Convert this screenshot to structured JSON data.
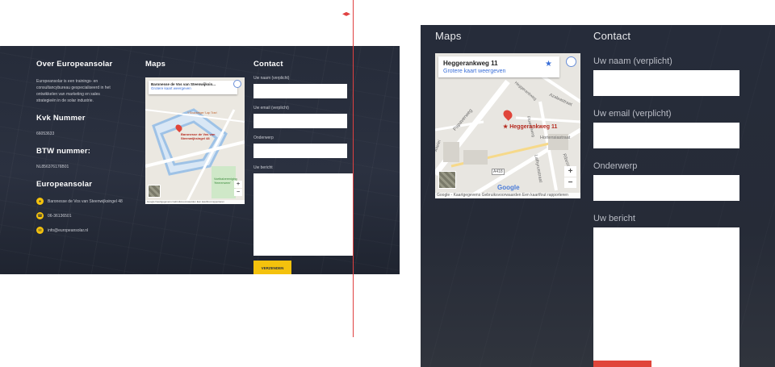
{
  "left": {
    "about": {
      "title": "Over Europeansolar",
      "text": "Europeansolar is een trainings- en consultancybureau gespecialiseerd in het ontwikkelen van marketing en sales strategieën in de solar industrie.",
      "kvk_title": "Kvk Nummer",
      "kvk_value": "66053633",
      "btw_title": "BTW nummer:",
      "btw_value": "NL856376176B01",
      "company_title": "Europeansolar",
      "contacts": [
        {
          "icon": "location-icon",
          "text": "Baronesse de Vos van Steenwijksingel 48"
        },
        {
          "icon": "phone-icon",
          "text": "06-36136501"
        },
        {
          "icon": "mail-icon",
          "text": "info@europeansolar.nl"
        }
      ]
    },
    "maps": {
      "title": "Maps",
      "place_name": "Baronesse de Vos van Steenwijksin...",
      "link": "Grotere kaart weergeven",
      "marker_label": "Baronesse de Vos van Steenwijksingel 48",
      "poi": "'t Snackeiger 'Lap Tran'",
      "poi2": "Voetbalvereniging 'Heerenveen'",
      "footer": "Google  Kaartgegevens  Gebruiksvoorwaarden  Een kaartfout rapporteren"
    },
    "contact": {
      "title": "Contact",
      "name_label": "Uw naam (verplicht)",
      "email_label": "Uw email (verplicht)",
      "subject_label": "Onderwerp",
      "message_label": "Uw bericht",
      "send_label": "VERZENDEN"
    }
  },
  "right": {
    "maps": {
      "title": "Maps",
      "place_name": "Heggerankweg 11",
      "link": "Grotere kaart weergeven",
      "marker_label": "Heggerankweg 11",
      "streets": [
        "Heggerankweg",
        "Azaleastraat",
        "Hortensiastraat",
        "Ribesstraat",
        "Lathyrusstraat",
        "Papaverweg",
        "Akelei",
        "Fluweelweg"
      ],
      "road_number": "A418",
      "google": "Google",
      "footer": "Google - Kaartgegevens   Gebruiksvoorwaarden   Een kaartfout rapporteren"
    },
    "contact": {
      "title": "Contact",
      "name_label": "Uw naam (verplicht)",
      "email_label": "Uw email (verplicht)",
      "subject_label": "Onderwerp",
      "message_label": "Uw bericht"
    }
  },
  "colors": {
    "panel": "#262c3a",
    "accent_yellow": "#f4c20d",
    "accent_red": "#e0453a",
    "guide_red": "#e04040"
  }
}
